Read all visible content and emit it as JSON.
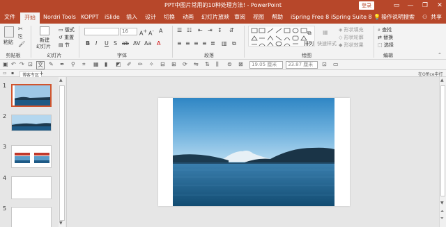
{
  "window": {
    "title": "PPT中图片常用的10种处理方法! - PowerPoint",
    "login_label": "登录",
    "minimize": "—",
    "restore": "❐",
    "close": "✕"
  },
  "tabs": [
    {
      "label": "文件"
    },
    {
      "label": "开始"
    },
    {
      "label": "Nordri Tools"
    },
    {
      "label": "KOPPT"
    },
    {
      "label": "iSlide"
    },
    {
      "label": "插入"
    },
    {
      "label": "设计"
    },
    {
      "label": "切换"
    },
    {
      "label": "动画"
    },
    {
      "label": "幻灯片放映"
    },
    {
      "label": "审阅"
    },
    {
      "label": "视图"
    },
    {
      "label": "帮助"
    },
    {
      "label": "iSpring Free 8"
    },
    {
      "label": "iSpring Suite 8"
    },
    {
      "label": "操作说明搜索"
    },
    {
      "label": "共享"
    }
  ],
  "ribbon": {
    "clipboard": {
      "paste": "粘贴",
      "group": "剪贴板"
    },
    "slides": {
      "new_slide": "新建",
      "new_slide2": "幻灯片",
      "layout": "版式",
      "reset": "重置",
      "section": "节",
      "group": "幻灯片"
    },
    "font": {
      "group": "字体",
      "font_placeholder": "",
      "size": "16"
    },
    "paragraph": {
      "group": "段落"
    },
    "drawing": {
      "arrange": "排列",
      "quick_styles": "快速样式",
      "fill": "形状填充",
      "outline": "形状轮廓",
      "effects": "形状效果",
      "group": "绘图"
    },
    "editing": {
      "find": "查找",
      "replace": "替换",
      "select": "选择",
      "group": "编辑"
    }
  },
  "qat": {
    "width_value": "19.05 厘米",
    "height_value": "33.87 厘米"
  },
  "file_strip": {
    "tab_label": "博客专区",
    "right_label": "在Office中打开"
  },
  "thumbnails": [
    {
      "number": "1"
    },
    {
      "number": "2"
    },
    {
      "number": "3"
    },
    {
      "number": "4"
    },
    {
      "number": "5"
    }
  ],
  "colors": {
    "accent": "#b7472a",
    "selection": "#d0542d"
  }
}
